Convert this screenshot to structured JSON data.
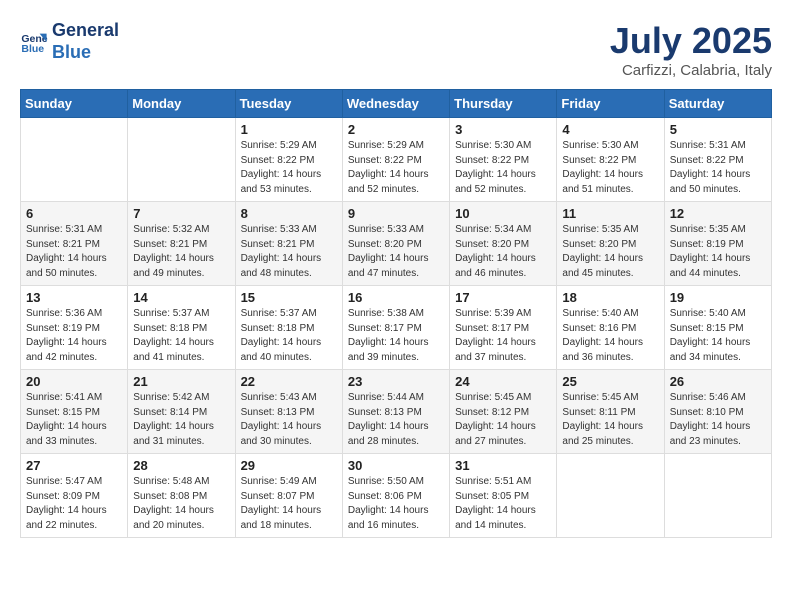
{
  "header": {
    "logo_line1": "General",
    "logo_line2": "Blue",
    "month": "July 2025",
    "location": "Carfizzi, Calabria, Italy"
  },
  "weekdays": [
    "Sunday",
    "Monday",
    "Tuesday",
    "Wednesday",
    "Thursday",
    "Friday",
    "Saturday"
  ],
  "weeks": [
    [
      {
        "day": "",
        "info": ""
      },
      {
        "day": "",
        "info": ""
      },
      {
        "day": "1",
        "info": "Sunrise: 5:29 AM\nSunset: 8:22 PM\nDaylight: 14 hours\nand 53 minutes."
      },
      {
        "day": "2",
        "info": "Sunrise: 5:29 AM\nSunset: 8:22 PM\nDaylight: 14 hours\nand 52 minutes."
      },
      {
        "day": "3",
        "info": "Sunrise: 5:30 AM\nSunset: 8:22 PM\nDaylight: 14 hours\nand 52 minutes."
      },
      {
        "day": "4",
        "info": "Sunrise: 5:30 AM\nSunset: 8:22 PM\nDaylight: 14 hours\nand 51 minutes."
      },
      {
        "day": "5",
        "info": "Sunrise: 5:31 AM\nSunset: 8:22 PM\nDaylight: 14 hours\nand 50 minutes."
      }
    ],
    [
      {
        "day": "6",
        "info": "Sunrise: 5:31 AM\nSunset: 8:21 PM\nDaylight: 14 hours\nand 50 minutes."
      },
      {
        "day": "7",
        "info": "Sunrise: 5:32 AM\nSunset: 8:21 PM\nDaylight: 14 hours\nand 49 minutes."
      },
      {
        "day": "8",
        "info": "Sunrise: 5:33 AM\nSunset: 8:21 PM\nDaylight: 14 hours\nand 48 minutes."
      },
      {
        "day": "9",
        "info": "Sunrise: 5:33 AM\nSunset: 8:20 PM\nDaylight: 14 hours\nand 47 minutes."
      },
      {
        "day": "10",
        "info": "Sunrise: 5:34 AM\nSunset: 8:20 PM\nDaylight: 14 hours\nand 46 minutes."
      },
      {
        "day": "11",
        "info": "Sunrise: 5:35 AM\nSunset: 8:20 PM\nDaylight: 14 hours\nand 45 minutes."
      },
      {
        "day": "12",
        "info": "Sunrise: 5:35 AM\nSunset: 8:19 PM\nDaylight: 14 hours\nand 44 minutes."
      }
    ],
    [
      {
        "day": "13",
        "info": "Sunrise: 5:36 AM\nSunset: 8:19 PM\nDaylight: 14 hours\nand 42 minutes."
      },
      {
        "day": "14",
        "info": "Sunrise: 5:37 AM\nSunset: 8:18 PM\nDaylight: 14 hours\nand 41 minutes."
      },
      {
        "day": "15",
        "info": "Sunrise: 5:37 AM\nSunset: 8:18 PM\nDaylight: 14 hours\nand 40 minutes."
      },
      {
        "day": "16",
        "info": "Sunrise: 5:38 AM\nSunset: 8:17 PM\nDaylight: 14 hours\nand 39 minutes."
      },
      {
        "day": "17",
        "info": "Sunrise: 5:39 AM\nSunset: 8:17 PM\nDaylight: 14 hours\nand 37 minutes."
      },
      {
        "day": "18",
        "info": "Sunrise: 5:40 AM\nSunset: 8:16 PM\nDaylight: 14 hours\nand 36 minutes."
      },
      {
        "day": "19",
        "info": "Sunrise: 5:40 AM\nSunset: 8:15 PM\nDaylight: 14 hours\nand 34 minutes."
      }
    ],
    [
      {
        "day": "20",
        "info": "Sunrise: 5:41 AM\nSunset: 8:15 PM\nDaylight: 14 hours\nand 33 minutes."
      },
      {
        "day": "21",
        "info": "Sunrise: 5:42 AM\nSunset: 8:14 PM\nDaylight: 14 hours\nand 31 minutes."
      },
      {
        "day": "22",
        "info": "Sunrise: 5:43 AM\nSunset: 8:13 PM\nDaylight: 14 hours\nand 30 minutes."
      },
      {
        "day": "23",
        "info": "Sunrise: 5:44 AM\nSunset: 8:13 PM\nDaylight: 14 hours\nand 28 minutes."
      },
      {
        "day": "24",
        "info": "Sunrise: 5:45 AM\nSunset: 8:12 PM\nDaylight: 14 hours\nand 27 minutes."
      },
      {
        "day": "25",
        "info": "Sunrise: 5:45 AM\nSunset: 8:11 PM\nDaylight: 14 hours\nand 25 minutes."
      },
      {
        "day": "26",
        "info": "Sunrise: 5:46 AM\nSunset: 8:10 PM\nDaylight: 14 hours\nand 23 minutes."
      }
    ],
    [
      {
        "day": "27",
        "info": "Sunrise: 5:47 AM\nSunset: 8:09 PM\nDaylight: 14 hours\nand 22 minutes."
      },
      {
        "day": "28",
        "info": "Sunrise: 5:48 AM\nSunset: 8:08 PM\nDaylight: 14 hours\nand 20 minutes."
      },
      {
        "day": "29",
        "info": "Sunrise: 5:49 AM\nSunset: 8:07 PM\nDaylight: 14 hours\nand 18 minutes."
      },
      {
        "day": "30",
        "info": "Sunrise: 5:50 AM\nSunset: 8:06 PM\nDaylight: 14 hours\nand 16 minutes."
      },
      {
        "day": "31",
        "info": "Sunrise: 5:51 AM\nSunset: 8:05 PM\nDaylight: 14 hours\nand 14 minutes."
      },
      {
        "day": "",
        "info": ""
      },
      {
        "day": "",
        "info": ""
      }
    ]
  ]
}
